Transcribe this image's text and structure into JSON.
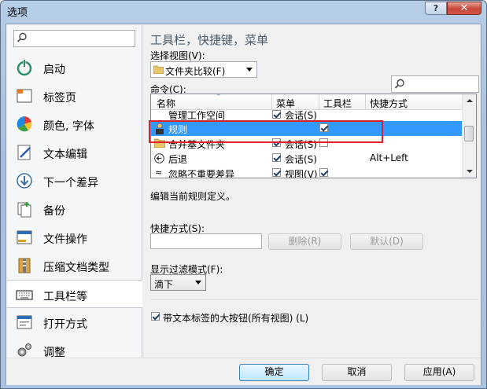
{
  "window": {
    "title": "选项",
    "help_glyph": "?",
    "close_glyph": "✕"
  },
  "sidebar": {
    "search_placeholder": "",
    "items": [
      {
        "label": "启动",
        "icon": "power-icon"
      },
      {
        "label": "标签页",
        "icon": "tabs-icon"
      },
      {
        "label": "颜色, 字体",
        "icon": "palette-icon"
      },
      {
        "label": "文本编辑",
        "icon": "edit-icon"
      },
      {
        "label": "下一个差异",
        "icon": "next-diff-icon"
      },
      {
        "label": "备份",
        "icon": "backup-icon"
      },
      {
        "label": "文件操作",
        "icon": "file-ops-icon"
      },
      {
        "label": "压缩文档类型",
        "icon": "archive-icon"
      },
      {
        "label": "工具栏等",
        "icon": "keyboard-icon"
      },
      {
        "label": "打开方式",
        "icon": "open-with-icon"
      },
      {
        "label": "调整",
        "icon": "gears-icon"
      }
    ],
    "selected": "工具栏等"
  },
  "main": {
    "heading": "工具栏，快捷键，菜单",
    "view_label": "选择视图(V):",
    "view_value": "文件夹比较(F)",
    "commands_label": "命令(C):",
    "columns": [
      "名称",
      "菜单",
      "工具栏",
      "快捷方式"
    ],
    "rows": [
      {
        "name": "管理工作空间",
        "menu_checked": true,
        "menu": "会话(S)",
        "toolbar_checked": false,
        "shortcut": ""
      },
      {
        "name": "规则",
        "menu_checked": false,
        "menu": "",
        "toolbar_checked": true,
        "shortcut": "",
        "selected": true
      },
      {
        "name": "合并基文件夹",
        "menu_checked": true,
        "menu": "会话(S)",
        "toolbar_checked": false,
        "shortcut": ""
      },
      {
        "name": "后退",
        "menu_checked": true,
        "menu": "会话(S)",
        "toolbar_checked": false,
        "shortcut": "Alt+Left"
      },
      {
        "name": "忽略不重要差异",
        "menu_checked": true,
        "menu": "视图(V)",
        "toolbar_checked": true,
        "shortcut": ""
      }
    ],
    "description": "编辑当前规则定义。",
    "shortcut_label": "快捷方式(S):",
    "shortcut_value": "",
    "delete_button": "删除(R)",
    "default_button": "默认(D)",
    "filter_label": "显示过滤模式(F):",
    "filter_value": "滴下",
    "big_buttons_label": "带文本标签的大按钮(所有视图) (L)",
    "big_buttons_checked": true
  },
  "footer": {
    "ok": "确定",
    "cancel": "取消",
    "apply": "应用(A)"
  },
  "colors": {
    "selection": "#3399ff",
    "highlight_box": "#e21f26",
    "titlebar": "#b6cde6"
  }
}
